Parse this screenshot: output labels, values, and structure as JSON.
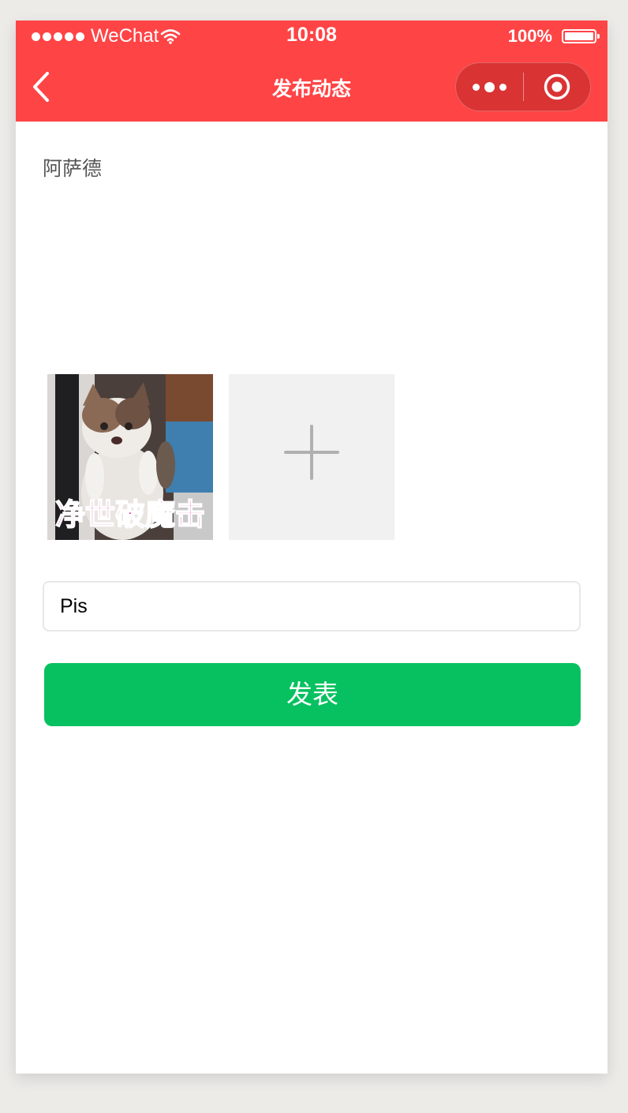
{
  "status_bar": {
    "carrier": "WeChat",
    "time": "10:08",
    "battery": "100%",
    "battery_level": 1.0
  },
  "nav": {
    "title": "发布动态"
  },
  "post": {
    "author": "阿萨德",
    "images": [
      {
        "caption": "净世破魔击"
      }
    ],
    "tag_value": "Pis",
    "submit_label": "发表"
  },
  "colors": {
    "header": "#ff4446",
    "primary_button": "#07c160",
    "caption": "#e0128c"
  },
  "icons": [
    "back-icon",
    "more-icon",
    "close-target-icon",
    "plus-icon",
    "wifi-icon",
    "battery-icon"
  ]
}
